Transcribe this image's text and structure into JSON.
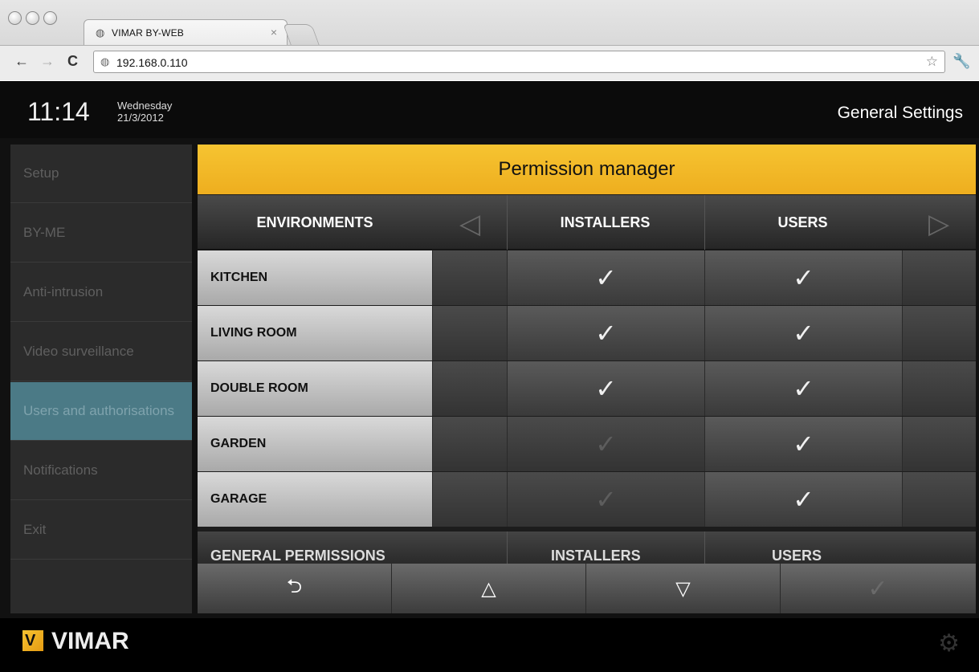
{
  "browser": {
    "tab_title": "VIMAR BY-WEB",
    "url": "192.168.0.110"
  },
  "header": {
    "time": "11:14",
    "day": "Wednesday",
    "date": "21/3/2012",
    "section": "General Settings"
  },
  "sidebar": {
    "items": [
      {
        "label": "Setup"
      },
      {
        "label": "BY-ME"
      },
      {
        "label": "Anti-intrusion"
      },
      {
        "label": "Video surveillance"
      },
      {
        "label": "Users and authorisations"
      },
      {
        "label": "Notifications"
      },
      {
        "label": "Exit"
      }
    ]
  },
  "permissions": {
    "title": "Permission manager",
    "columns": {
      "environments": "ENVIRONMENTS",
      "installers": "INSTALLERS",
      "users": "USERS"
    },
    "rows": [
      {
        "name": "KITCHEN",
        "installers": true,
        "users": true
      },
      {
        "name": "LIVING ROOM",
        "installers": true,
        "users": true
      },
      {
        "name": "DOUBLE ROOM",
        "installers": true,
        "users": true
      },
      {
        "name": "GARDEN",
        "installers": false,
        "users": true
      },
      {
        "name": "GARAGE",
        "installers": false,
        "users": true
      }
    ],
    "general_row": {
      "label": "GENERAL PERMISSIONS",
      "installers": "INSTALLERS",
      "users": "USERS"
    }
  },
  "brand": {
    "name": "VIMAR",
    "accent": "#f0b323",
    "active_bg": "#4b7a86"
  },
  "icons": {
    "back": "back-arrow-icon",
    "up": "up-triangle-icon",
    "down": "down-triangle-icon",
    "confirm": "check-icon",
    "settings": "gear-icon"
  }
}
